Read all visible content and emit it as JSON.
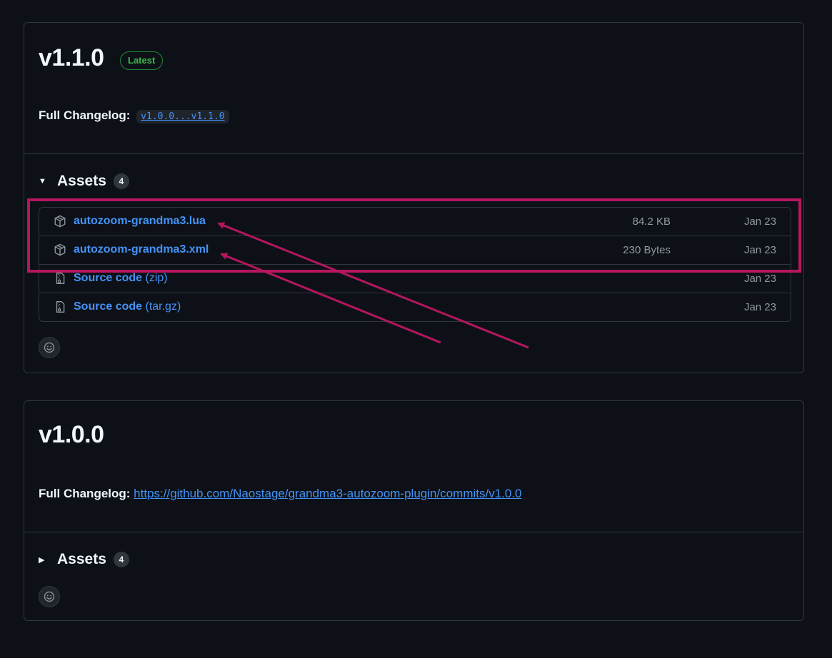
{
  "releases": [
    {
      "title": "v1.1.0",
      "badge": "Latest",
      "changelog_label": "Full Changelog:",
      "changelog_link": "v1.0.0...v1.1.0",
      "assets_label": "Assets",
      "assets_count": "4",
      "assets_expanded": true,
      "assets": [
        {
          "name": "autozoom-grandma3.lua",
          "suffix": "",
          "size": "84.2 KB",
          "date": "Jan 23",
          "icon": "package-icon"
        },
        {
          "name": "autozoom-grandma3.xml",
          "suffix": "",
          "size": "230 Bytes",
          "date": "Jan 23",
          "icon": "package-icon"
        },
        {
          "name": "Source code",
          "suffix": "(zip)",
          "size": "",
          "date": "Jan 23",
          "icon": "file-zip-icon"
        },
        {
          "name": "Source code",
          "suffix": "(tar.gz)",
          "size": "",
          "date": "Jan 23",
          "icon": "file-zip-icon"
        }
      ]
    },
    {
      "title": "v1.0.0",
      "changelog_label": "Full Changelog:",
      "changelog_link": "https://github.com/Naostage/grandma3-autozoom-plugin/commits/v1.0.0",
      "assets_label": "Assets",
      "assets_count": "4",
      "assets_expanded": false
    }
  ],
  "icons": {
    "expanded_caret": "triangle-down-icon",
    "collapsed_caret": "triangle-right-icon",
    "reaction": "smiley-icon"
  },
  "colors": {
    "background": "#0d1117",
    "link": "#4493f8",
    "latest_badge": "#3fb950",
    "annotation": "#b5165f",
    "border": "#30363d"
  }
}
